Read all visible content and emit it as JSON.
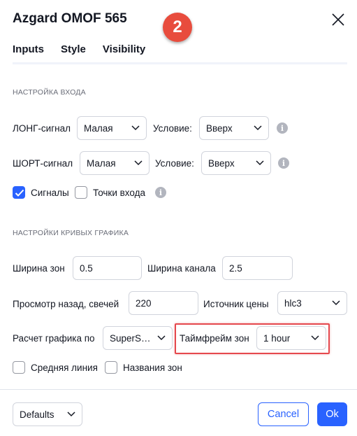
{
  "dialog": {
    "title": "Azgard OMOF 565",
    "badge_number": "2",
    "close_icon": "close-icon"
  },
  "tabs": [
    {
      "label": "Inputs",
      "active": true
    },
    {
      "label": "Style",
      "active": false
    },
    {
      "label": "Visibility",
      "active": false
    }
  ],
  "sections": {
    "input_settings": "НАСТРОЙКА ВХОДА",
    "curve_settings": "НАСТРОЙКИ КРИВЫХ ГРАФИКА"
  },
  "long_signal": {
    "label": "ЛОНГ-сигнал",
    "value": "Малая",
    "condition_label": "Условие:",
    "condition_value": "Вверх"
  },
  "short_signal": {
    "label": "ШОРТ-сигнал",
    "value": "Малая",
    "condition_label": "Условие:",
    "condition_value": "Вверх"
  },
  "checkboxes_row1": {
    "signals": {
      "label": "Сигналы",
      "checked": true
    },
    "entry_points": {
      "label": "Точки входа",
      "checked": false
    }
  },
  "zone_width": {
    "label": "Ширина зон",
    "value": "0.5"
  },
  "channel_width": {
    "label": "Ширина канала",
    "value": "2.5"
  },
  "lookback": {
    "label": "Просмотр назад, свечей",
    "value": "220"
  },
  "price_source": {
    "label": "Источник цены",
    "value": "hlc3"
  },
  "calc_by": {
    "label": "Расчет графика по",
    "value": "SuperSm…"
  },
  "zone_timeframe": {
    "label": "Таймфрейм зон",
    "value": "1 hour"
  },
  "checkboxes_row2": {
    "middle_line": {
      "label": "Средняя линия",
      "checked": false
    },
    "zone_names": {
      "label": "Названия зон",
      "checked": false
    }
  },
  "footer": {
    "defaults": "Defaults",
    "cancel": "Cancel",
    "ok": "Ok"
  },
  "colors": {
    "accent": "#2962ff",
    "highlight": "#e5484d",
    "badge": "#e84c3d"
  }
}
